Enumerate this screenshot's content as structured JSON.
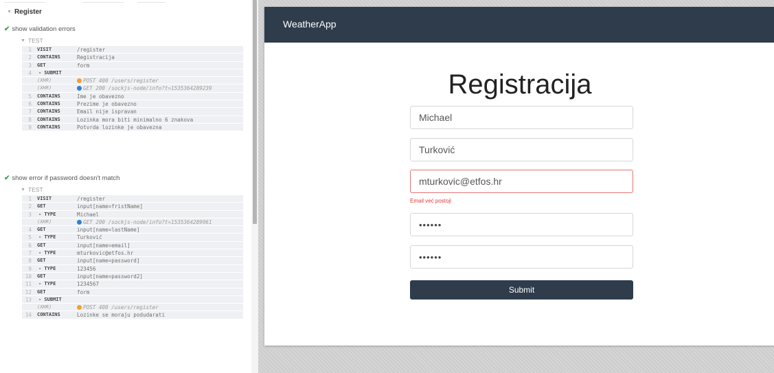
{
  "runner": {
    "suite": "Register",
    "tests": [
      {
        "title": "show validation errors",
        "label": "TEST",
        "commands": [
          {
            "num": "1",
            "name": "VISIT",
            "msg": "/register"
          },
          {
            "num": "2",
            "name": "CONTAINS",
            "msg": "Registracija"
          },
          {
            "num": "3",
            "name": "GET",
            "msg": "form"
          },
          {
            "num": "4",
            "name": "- SUBMIT",
            "msg": ""
          },
          {
            "num": "",
            "name": "(XHR)",
            "msg": "POST 400 /users/register",
            "xhr": true,
            "dot": "#f0a030"
          },
          {
            "num": "",
            "name": "(XHR)",
            "msg": "GET 200 /sockjs-node/info?t=1535364289239",
            "xhr": true,
            "dot": "#2f7fd6"
          },
          {
            "num": "5",
            "name": "CONTAINS",
            "msg": "Ime je obavezno"
          },
          {
            "num": "6",
            "name": "CONTAINS",
            "msg": "Prezime je obavezno"
          },
          {
            "num": "7",
            "name": "CONTAINS",
            "msg": "Email nije ispravan"
          },
          {
            "num": "8",
            "name": "CONTAINS",
            "msg": "Lozinka mora biti minimalno 6 znakova"
          },
          {
            "num": "9",
            "name": "CONTAINS",
            "msg": "Potvrda lozinke je obavezna"
          }
        ]
      },
      {
        "title": "show error if password doesn't match",
        "label": "TEST",
        "commands": [
          {
            "num": "1",
            "name": "VISIT",
            "msg": "/register"
          },
          {
            "num": "2",
            "name": "GET",
            "msg": "input[name=fristName]"
          },
          {
            "num": "3",
            "name": "- TYPE",
            "msg": "Michael"
          },
          {
            "num": "",
            "name": "(XHR)",
            "msg": "GET 200 /sockjs-node/info?t=1535364289961",
            "xhr": true,
            "dot": "#2f7fd6"
          },
          {
            "num": "4",
            "name": "GET",
            "msg": "input[name=lastName]"
          },
          {
            "num": "5",
            "name": "- TYPE",
            "msg": "Turković"
          },
          {
            "num": "6",
            "name": "GET",
            "msg": "input[name=email]"
          },
          {
            "num": "7",
            "name": "- TYPE",
            "msg": "mturkovic@etfos.hr"
          },
          {
            "num": "8",
            "name": "GET",
            "msg": "input[name=password]"
          },
          {
            "num": "9",
            "name": "- TYPE",
            "msg": "123456"
          },
          {
            "num": "10",
            "name": "GET",
            "msg": "input[name=password2]"
          },
          {
            "num": "11",
            "name": "- TYPE",
            "msg": "1234567"
          },
          {
            "num": "12",
            "name": "GET",
            "msg": "form"
          },
          {
            "num": "13",
            "name": "- SUBMIT",
            "msg": ""
          },
          {
            "num": "",
            "name": "(XHR)",
            "msg": "POST 400 /users/register",
            "xhr": true,
            "dot": "#f0a030"
          },
          {
            "num": "14",
            "name": "CONTAINS",
            "msg": "Lozinke se moraju podudarati"
          }
        ]
      }
    ]
  },
  "app": {
    "brand": "WeatherApp",
    "heading": "Registracija",
    "first_name": "Michael",
    "last_name": "Turković",
    "email": "mturkovic@etfos.hr",
    "email_error": "Email već postoji",
    "password": "••••••",
    "password2": "••••••",
    "submit_label": "Submit"
  },
  "colors": {
    "navbar": "#2e3c4c",
    "pass_check": "#38a64a",
    "error": "#e53935",
    "xhr_post": "#f0a030",
    "xhr_get": "#2f7fd6"
  }
}
